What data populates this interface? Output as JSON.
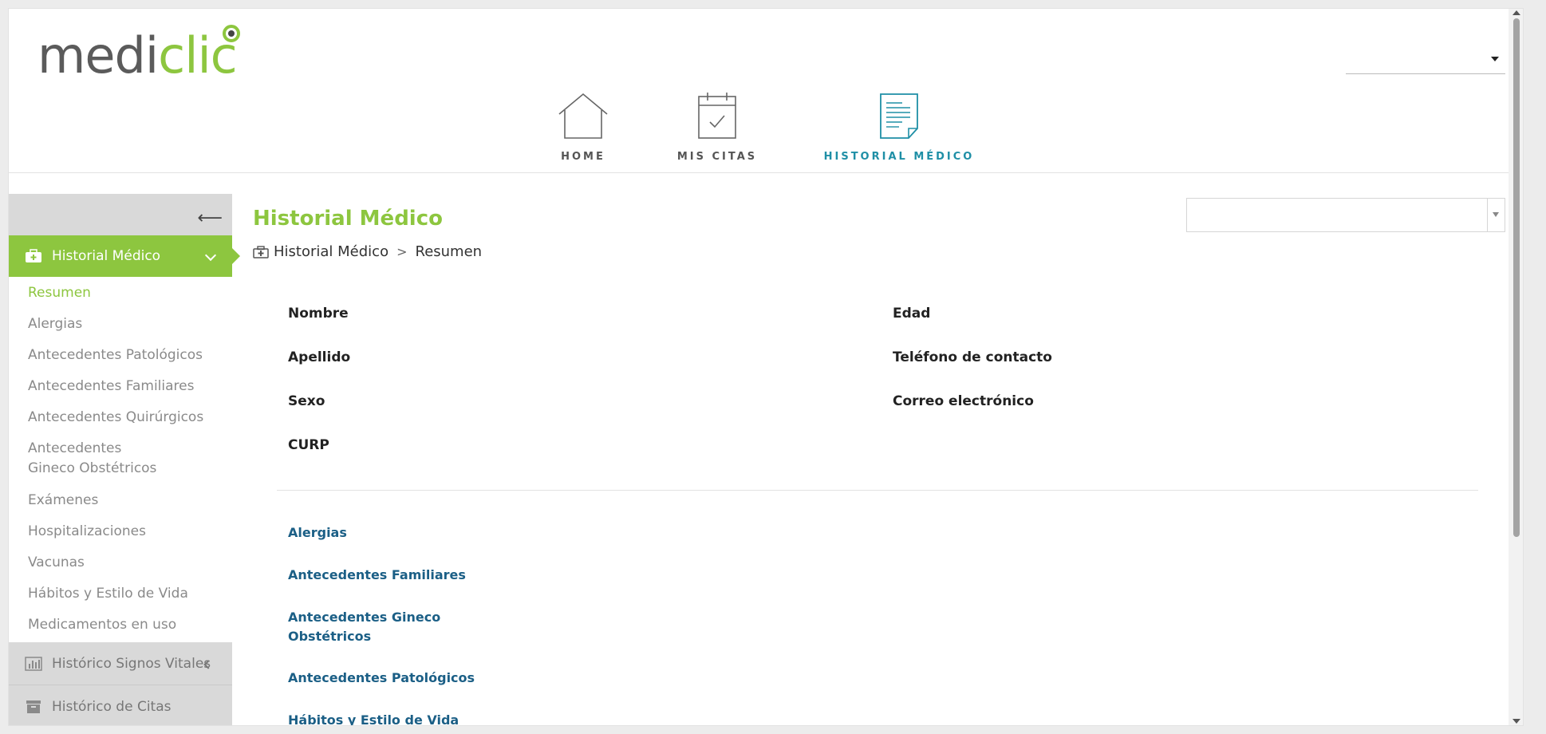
{
  "logo": {
    "part1": "medi",
    "part2": "clic"
  },
  "nav": [
    {
      "label": "HOME",
      "icon": "home-icon"
    },
    {
      "label": "MIS CITAS",
      "icon": "calendar-check-icon"
    },
    {
      "label": "HISTORIAL MÉDICO",
      "icon": "document-icon"
    }
  ],
  "colors": {
    "brand_green": "#8dc63f",
    "active_blue": "#1f8fa6",
    "link_blue": "#1b5f86"
  },
  "sidebar": {
    "active_section": "Historial Médico",
    "items": [
      "Resumen",
      "Alergias",
      "Antecedentes Patológicos",
      "Antecedentes Familiares",
      "Antecedentes Quirúrgicos",
      "Antecedentes Gineco Obstétricos",
      "Exámenes",
      "Hospitalizaciones",
      "Vacunas",
      "Hábitos y Estilo de Vida",
      "Medicamentos en uso"
    ],
    "groups": [
      "Histórico Signos Vitales",
      "Histórico de Citas"
    ]
  },
  "main": {
    "title": "Historial Médico",
    "breadcrumb": {
      "root": "Historial Médico",
      "sep": ">",
      "current": "Resumen"
    },
    "fields_left": [
      "Nombre",
      "Apellido",
      "Sexo",
      "CURP"
    ],
    "fields_right": [
      "Edad",
      "Teléfono de contacto",
      "Correo electrónico"
    ],
    "links": [
      "Alergias",
      "Antecedentes Familiares",
      "Antecedentes Gineco Obstétricos",
      "Antecedentes Patológicos",
      "Hábitos y Estilo de Vida"
    ]
  }
}
